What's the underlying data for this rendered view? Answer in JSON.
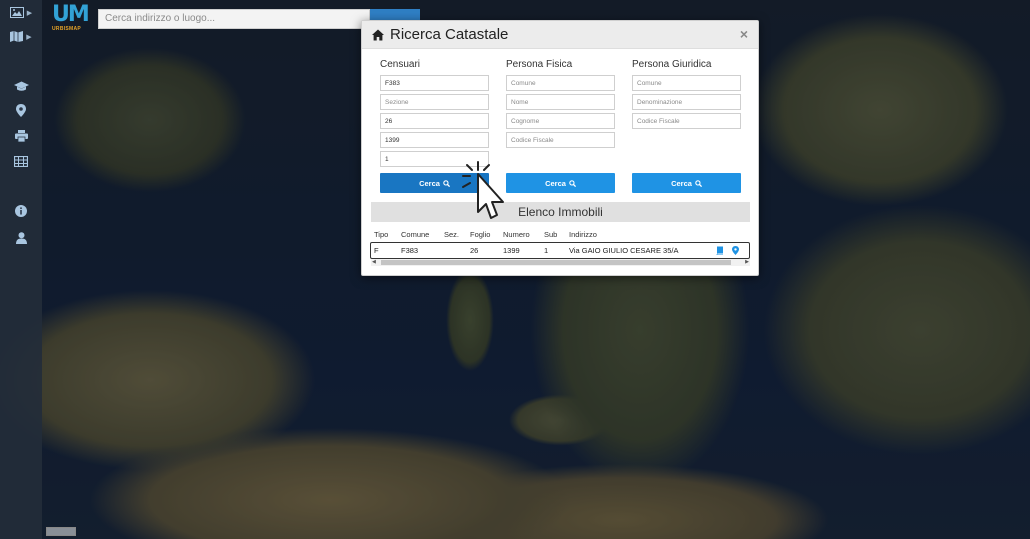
{
  "search": {
    "placeholder": "Cerca indirizzo o luogo..."
  },
  "logo": {
    "main": "UM",
    "sub": "URBISMAP"
  },
  "modal": {
    "title": "Ricerca Catastale",
    "close": "×",
    "columns": {
      "censuari": {
        "heading": "Censuari",
        "fields": [
          {
            "value": "F383",
            "placeholder": ""
          },
          {
            "value": "",
            "placeholder": "Sezione"
          },
          {
            "value": "26",
            "placeholder": ""
          },
          {
            "value": "1399",
            "placeholder": ""
          },
          {
            "value": "1",
            "placeholder": ""
          }
        ],
        "button": "Cerca"
      },
      "persona_fisica": {
        "heading": "Persona Fisica",
        "fields": [
          {
            "placeholder": "Comune"
          },
          {
            "placeholder": "Nome"
          },
          {
            "placeholder": "Cognome"
          },
          {
            "placeholder": "Codice Fiscale"
          }
        ],
        "button": "Cerca"
      },
      "persona_giuridica": {
        "heading": "Persona Giuridica",
        "fields": [
          {
            "placeholder": "Comune"
          },
          {
            "placeholder": "Denominazione"
          },
          {
            "placeholder": "Codice Fiscale"
          }
        ],
        "button": "Cerca"
      }
    },
    "results": {
      "title": "Elenco Immobili",
      "headers": [
        "Tipo",
        "Comune",
        "Sez.",
        "Foglio",
        "Numero",
        "Sub",
        "Indirizzo"
      ],
      "rows": [
        [
          "F",
          "F383",
          "",
          "26",
          "1399",
          "1",
          "Via GAIO GIULIO CESARE 35/A"
        ]
      ]
    }
  },
  "colors": {
    "accent": "#1f93e4",
    "accent_active": "#1976c2",
    "sidebar_icon": "#a9c6e0"
  }
}
